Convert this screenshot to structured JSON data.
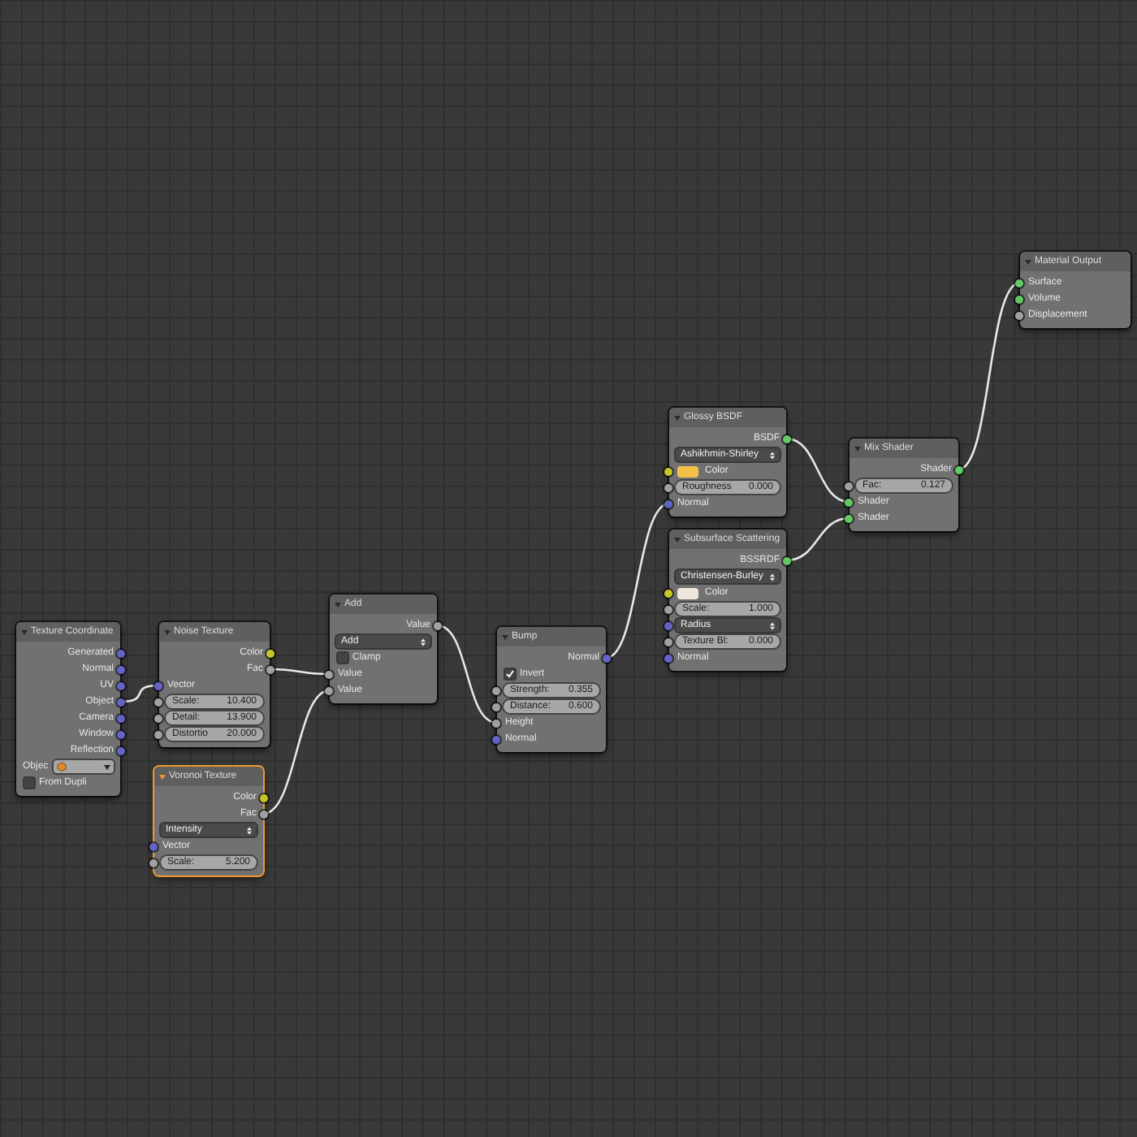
{
  "nodes": [
    {
      "title": "Texture Coordinate",
      "selected": false,
      "rows": [
        {
          "kind": "output",
          "label": "Generated",
          "color": "#6363c7"
        },
        {
          "kind": "output",
          "label": "Normal",
          "color": "#6363c7"
        },
        {
          "kind": "output",
          "label": "UV",
          "color": "#6363c7"
        },
        {
          "kind": "output",
          "label": "Object",
          "color": "#6363c7"
        },
        {
          "kind": "output",
          "label": "Camera",
          "color": "#6363c7"
        },
        {
          "kind": "output",
          "label": "Window",
          "color": "#6363c7"
        },
        {
          "kind": "output",
          "label": "Reflection",
          "color": "#6363c7"
        },
        {
          "kind": "picker",
          "label": "Objec"
        },
        {
          "kind": "checkbox",
          "label": "From Dupli",
          "checked": false
        }
      ]
    },
    {
      "title": "Noise Texture",
      "selected": false,
      "rows": [
        {
          "kind": "output",
          "label": "Color",
          "color": "#c7c729"
        },
        {
          "kind": "output",
          "label": "Fac",
          "color": "#a1a1a1"
        },
        {
          "kind": "input",
          "label": "Vector",
          "color": "#6363c7"
        },
        {
          "kind": "field",
          "label": "Scale:",
          "value": "10.400",
          "color": "#a1a1a1"
        },
        {
          "kind": "field",
          "label": "Detail:",
          "value": "13.900",
          "color": "#a1a1a1"
        },
        {
          "kind": "field",
          "label": "Distortio",
          "value": "20.000",
          "color": "#a1a1a1"
        }
      ]
    },
    {
      "title": "Voronoi Texture",
      "selected": true,
      "rows": [
        {
          "kind": "output",
          "label": "Color",
          "color": "#c7c729"
        },
        {
          "kind": "output",
          "label": "Fac",
          "color": "#a1a1a1"
        },
        {
          "kind": "dropdown",
          "label": "Intensity"
        },
        {
          "kind": "input",
          "label": "Vector",
          "color": "#6363c7"
        },
        {
          "kind": "field",
          "label": "Scale:",
          "value": "5.200",
          "color": "#a1a1a1"
        }
      ]
    },
    {
      "title": "Add",
      "selected": false,
      "rows": [
        {
          "kind": "output",
          "label": "Value",
          "color": "#a1a1a1"
        },
        {
          "kind": "dropdown",
          "label": "Add"
        },
        {
          "kind": "checkbox",
          "label": "Clamp",
          "checked": false
        },
        {
          "kind": "input",
          "label": "Value",
          "color": "#a1a1a1"
        },
        {
          "kind": "input",
          "label": "Value",
          "color": "#a1a1a1"
        }
      ]
    },
    {
      "title": "Bump",
      "selected": false,
      "rows": [
        {
          "kind": "output",
          "label": "Normal",
          "color": "#6363c7"
        },
        {
          "kind": "checkbox",
          "label": "Invert",
          "checked": true
        },
        {
          "kind": "field",
          "label": "Strength:",
          "value": "0.355",
          "color": "#a1a1a1"
        },
        {
          "kind": "field",
          "label": "Distance:",
          "value": "0.600",
          "color": "#a1a1a1"
        },
        {
          "kind": "input",
          "label": "Height",
          "color": "#a1a1a1"
        },
        {
          "kind": "input",
          "label": "Normal",
          "color": "#6363c7"
        }
      ]
    },
    {
      "title": "Glossy BSDF",
      "selected": false,
      "rows": [
        {
          "kind": "output",
          "label": "BSDF",
          "color": "#63c763"
        },
        {
          "kind": "dropdown",
          "label": "Ashikhmin-Shirley"
        },
        {
          "kind": "swatch",
          "label": "Color",
          "color": "#f5c04a"
        },
        {
          "kind": "field",
          "label": "Roughness",
          "value": "0.000",
          "color": "#a1a1a1"
        },
        {
          "kind": "input",
          "label": "Normal",
          "color": "#6363c7"
        }
      ]
    },
    {
      "title": "Subsurface Scattering",
      "selected": false,
      "rows": [
        {
          "kind": "output",
          "label": "BSSRDF",
          "color": "#63c763"
        },
        {
          "kind": "dropdown",
          "label": "Christensen-Burley"
        },
        {
          "kind": "swatch",
          "label": "Color",
          "color": "#efe6dc"
        },
        {
          "kind": "field",
          "label": "Scale:",
          "value": "1.000",
          "color": "#a1a1a1"
        },
        {
          "kind": "dropdown",
          "label": "Radius",
          "color": "#6363c7"
        },
        {
          "kind": "field",
          "label": "Texture Bl:",
          "value": "0.000",
          "color": "#a1a1a1"
        },
        {
          "kind": "input",
          "label": "Normal",
          "color": "#6363c7"
        }
      ]
    },
    {
      "title": "Mix Shader",
      "selected": false,
      "rows": [
        {
          "kind": "output",
          "label": "Shader",
          "color": "#63c763"
        },
        {
          "kind": "field",
          "label": "Fac:",
          "value": "0.127",
          "color": "#a1a1a1"
        },
        {
          "kind": "input",
          "label": "Shader",
          "color": "#63c763"
        },
        {
          "kind": "input",
          "label": "Shader",
          "color": "#63c763"
        }
      ]
    },
    {
      "title": "Material Output",
      "selected": false,
      "rows": [
        {
          "kind": "input",
          "label": "Surface",
          "color": "#63c763"
        },
        {
          "kind": "input",
          "label": "Volume",
          "color": "#63c763"
        },
        {
          "kind": "input",
          "label": "Displacement",
          "color": "#a1a1a1"
        }
      ]
    }
  ]
}
